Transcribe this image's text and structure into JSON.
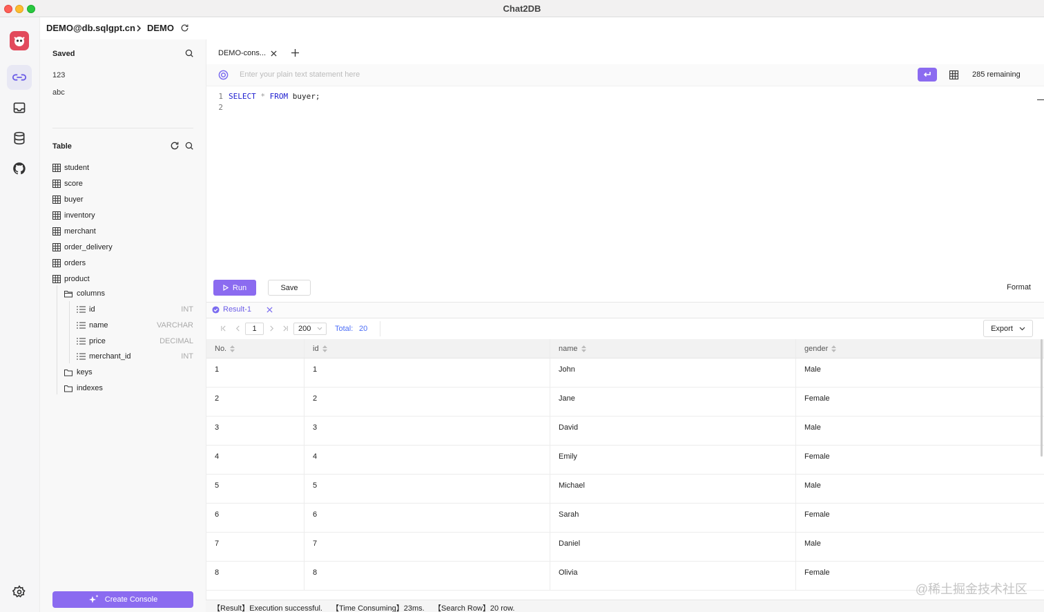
{
  "window": {
    "title": "Chat2DB"
  },
  "header": {
    "connection": "DEMO@db.sqlgpt.cn",
    "database": "DEMO"
  },
  "sidebar": {
    "saved_title": "Saved",
    "saved_items": [
      "123",
      "abc"
    ],
    "table_title": "Table",
    "tables": [
      "student",
      "score",
      "buyer",
      "inventory",
      "merchant",
      "order_delivery",
      "orders",
      "product"
    ],
    "product_children": {
      "columns_label": "columns",
      "columns": [
        {
          "name": "id",
          "type": "INT"
        },
        {
          "name": "name",
          "type": "VARCHAR"
        },
        {
          "name": "price",
          "type": "DECIMAL"
        },
        {
          "name": "merchant_id",
          "type": "INT"
        }
      ],
      "keys_label": "keys",
      "indexes_label": "indexes"
    },
    "create_console": "Create Console"
  },
  "editor": {
    "tab_label": "DEMO-cons...",
    "ai_placeholder": "Enter your plain text statement here",
    "remaining": "285 remaining",
    "line_numbers": [
      "1",
      "2"
    ],
    "code": {
      "kw1": "SELECT",
      "star": "*",
      "kw2": "FROM",
      "rest": "buyer;"
    },
    "run_label": "Run",
    "save_label": "Save",
    "format_label": "Format"
  },
  "result": {
    "tab_label": "Result-1",
    "page": "1",
    "page_size": "200",
    "total_label": "Total:",
    "total_value": "20",
    "export_label": "Export",
    "columns": [
      "No.",
      "id",
      "name",
      "gender"
    ],
    "rows": [
      [
        "1",
        "1",
        "John",
        "Male"
      ],
      [
        "2",
        "2",
        "Jane",
        "Female"
      ],
      [
        "3",
        "3",
        "David",
        "Male"
      ],
      [
        "4",
        "4",
        "Emily",
        "Female"
      ],
      [
        "5",
        "5",
        "Michael",
        "Male"
      ],
      [
        "6",
        "6",
        "Sarah",
        "Female"
      ],
      [
        "7",
        "7",
        "Daniel",
        "Male"
      ],
      [
        "8",
        "8",
        "Olivia",
        "Female"
      ]
    ]
  },
  "status": {
    "result": "【Result】Execution successful.",
    "time": "【Time Consuming】23ms.",
    "rows": "【Search Row】20 row."
  },
  "watermark": "@稀土掘金技术社区",
  "colors": {
    "accent": "#8b6bf0",
    "keyword": "#1c1ccf"
  }
}
